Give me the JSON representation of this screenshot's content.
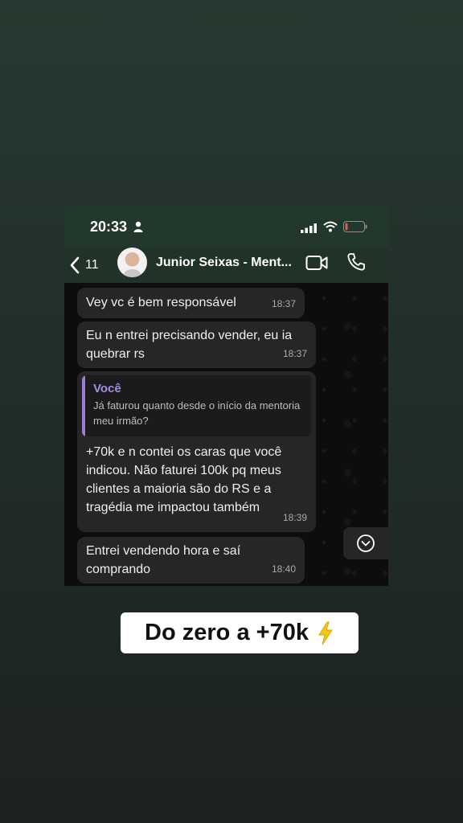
{
  "status_bar": {
    "time": "20:33"
  },
  "header": {
    "back_count": "11",
    "contact_name": "Junior Seixas - Ment..."
  },
  "messages": [
    {
      "text": "Vey vc é bem responsável",
      "time": "18:37"
    },
    {
      "text": "Eu n entrei precisando vender, eu ia quebrar rs",
      "time": "18:37"
    },
    {
      "quote_author": "Você",
      "quote_text": "Já faturou quanto desde o início da mentoria meu irmão?",
      "text": "+70k e n contei os caras que você indicou. Não faturei 100k pq meus clientes a maioria são do RS e a tragédia me impactou também",
      "time": "18:39"
    },
    {
      "text": "Entrei vendendo hora e saí comprando",
      "time": "18:40"
    }
  ],
  "caption": {
    "text": "Do zero a +70k",
    "emoji_icon": "high-voltage-icon"
  },
  "colors": {
    "quote_accent": "#9a7ed6",
    "quote_author": "#a58be3",
    "battery_low": "#e3574c"
  }
}
